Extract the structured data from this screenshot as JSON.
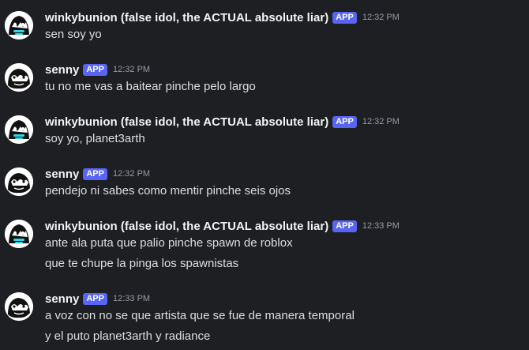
{
  "messages": [
    {
      "author": "winkybunion (false idol, the ACTUAL absolute liar)",
      "badge": "APP",
      "time": "12:32 PM",
      "avatar_icon": "black-white-creature-avatar-cyan",
      "lines": [
        "sen soy yo"
      ]
    },
    {
      "author": "senny",
      "badge": "APP",
      "time": "12:32 PM",
      "avatar_icon": "black-white-creature-avatar",
      "lines": [
        "tu no me vas a baitear pinche pelo largo"
      ]
    },
    {
      "author": "winkybunion (false idol, the ACTUAL absolute liar)",
      "badge": "APP",
      "time": "12:32 PM",
      "avatar_icon": "black-white-creature-avatar-cyan",
      "lines": [
        "soy yo, planet3arth"
      ]
    },
    {
      "author": "senny",
      "badge": "APP",
      "time": "12:32 PM",
      "avatar_icon": "black-white-creature-avatar",
      "lines": [
        "pendejo ni sabes como mentir pinche seis ojos"
      ]
    },
    {
      "author": "winkybunion (false idol, the ACTUAL absolute liar)",
      "badge": "APP",
      "time": "12:33 PM",
      "avatar_icon": "black-white-creature-avatar-cyan",
      "lines": [
        "ante ala puta que palio pinche spawn de roblox",
        "que te chupe la pinga los spawnistas"
      ]
    },
    {
      "author": "senny",
      "badge": "APP",
      "time": "12:33 PM",
      "avatar_icon": "black-white-creature-avatar",
      "lines": [
        "a voz con no se que artista que se fue de manera temporal",
        "y el puto planet3arth y radiance"
      ]
    }
  ],
  "colors": {
    "background": "#1e1f23",
    "username": "#f2f3f5",
    "message_text": "#dbdee1",
    "timestamp": "#949ba4",
    "app_badge": "#5865f2",
    "avatar_accent": "#33d6e6"
  }
}
